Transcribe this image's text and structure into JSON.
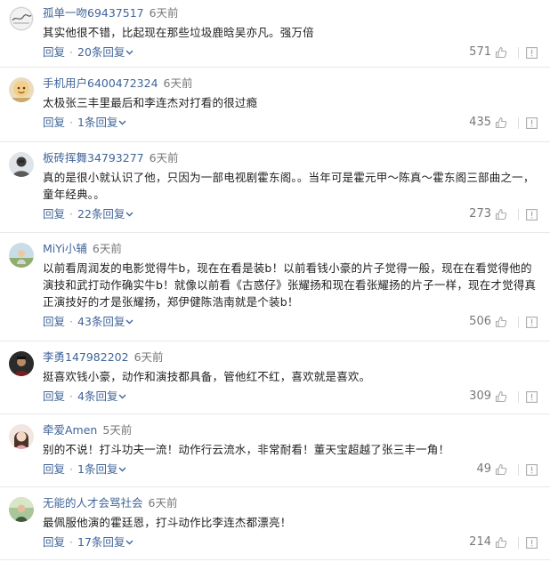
{
  "colors": {
    "link": "#406599",
    "meta": "#777777",
    "text": "#222222",
    "divider": "#e8e8e8"
  },
  "comments": [
    {
      "username": "孤单一吻69437517",
      "time": "6天前",
      "text": "其实他很不错，比起现在那些垃圾鹿晗吴亦凡。强万倍",
      "reply_label": "回复",
      "replies_label": "20条回复",
      "likes": "571",
      "avatar_icon": "avatar-sketch-icon"
    },
    {
      "username": "手机用户6400472324",
      "time": "6天前",
      "text": "太极张三丰里最后和李连杰对打看的很过瘾",
      "reply_label": "回复",
      "replies_label": "1条回复",
      "likes": "435",
      "avatar_icon": "avatar-cartoon-icon"
    },
    {
      "username": "板砖挥舞34793277",
      "time": "6天前",
      "text": "真的是很小就认识了他，只因为一部电视剧霍东阁。。当年可是霍元甲～陈真～霍东阁三部曲之一，童年经典。。",
      "reply_label": "回复",
      "replies_label": "22条回复",
      "likes": "273",
      "avatar_icon": "avatar-person-icon"
    },
    {
      "username": "MiYi小辅",
      "time": "6天前",
      "text": "以前看周润发的电影觉得牛b，现在在看是装b！以前看钱小豪的片子觉得一般，现在在看觉得他的演技和武打动作确实牛b！就像以前看《古惑仔》张耀扬和现在看张耀扬的片子一样，现在才觉得真正演技好的才是张耀扬，郑伊健陈浩南就是个装b！",
      "reply_label": "回复",
      "replies_label": "43条回复",
      "likes": "506",
      "avatar_icon": "avatar-outdoor-icon"
    },
    {
      "username": "李勇147982202",
      "time": "6天前",
      "text": "挺喜欢钱小豪，动作和演技都具备，管他红不红，喜欢就是喜欢。",
      "reply_label": "回复",
      "replies_label": "4条回复",
      "likes": "309",
      "avatar_icon": "avatar-dark-icon"
    },
    {
      "username": "牵爱Amen",
      "time": "5天前",
      "text": "别的不说！打斗功夫一流！动作行云流水，非常耐看！董天宝超越了张三丰一角！",
      "reply_label": "回复",
      "replies_label": "1条回复",
      "likes": "49",
      "avatar_icon": "avatar-girl-icon"
    },
    {
      "username": "无能的人才会骂社会",
      "time": "6天前",
      "text": "最佩服他演的霍廷恩，打斗动作比李连杰都漂亮！",
      "reply_label": "回复",
      "replies_label": "17条回复",
      "likes": "214",
      "avatar_icon": "avatar-landscape-icon"
    }
  ]
}
